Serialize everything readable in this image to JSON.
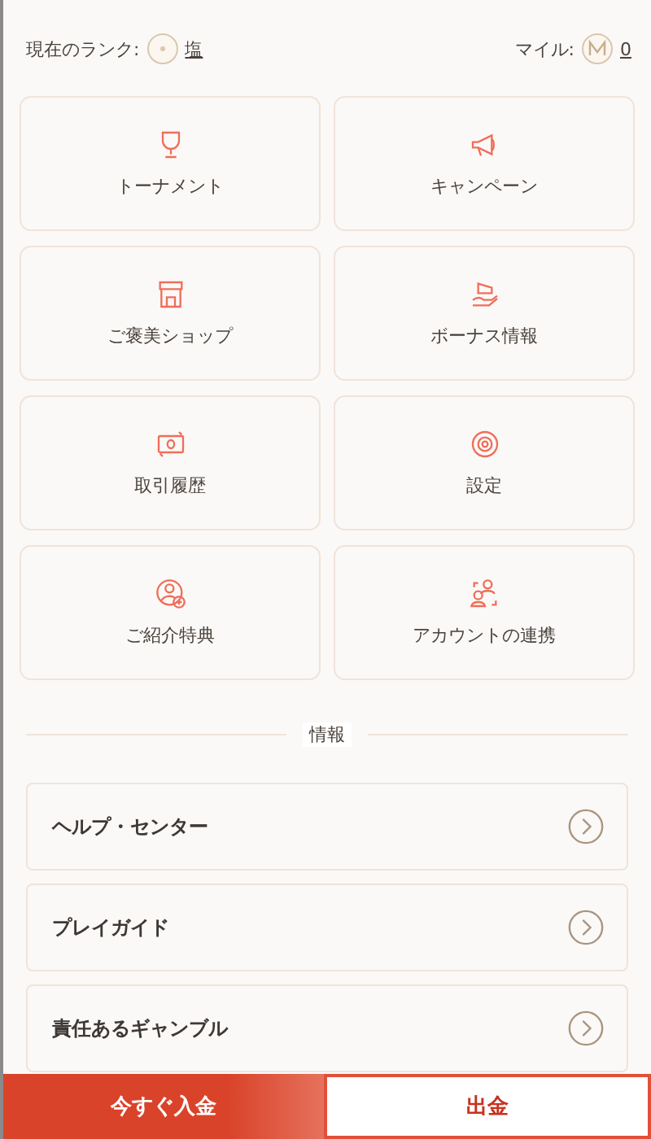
{
  "header": {
    "rank_label": "現在のランク:",
    "rank_value": "塩",
    "miles_label": "マイル:",
    "miles_value": "0"
  },
  "tiles": [
    {
      "label": "トーナメント"
    },
    {
      "label": "キャンペーン"
    },
    {
      "label": "ご褒美ショップ"
    },
    {
      "label": "ボーナス情報"
    },
    {
      "label": "取引履歴"
    },
    {
      "label": "設定"
    },
    {
      "label": "ご紹介特典"
    },
    {
      "label": "アカウントの連携"
    }
  ],
  "section_title": "情報",
  "links": [
    {
      "label": "ヘルプ・センター"
    },
    {
      "label": "プレイガイド"
    },
    {
      "label": "責任あるギャンブル"
    }
  ],
  "buttons": [
    {
      "label": "今すぐ入金",
      "kind": "primary"
    },
    {
      "label": "出金",
      "kind": "secondary"
    }
  ]
}
